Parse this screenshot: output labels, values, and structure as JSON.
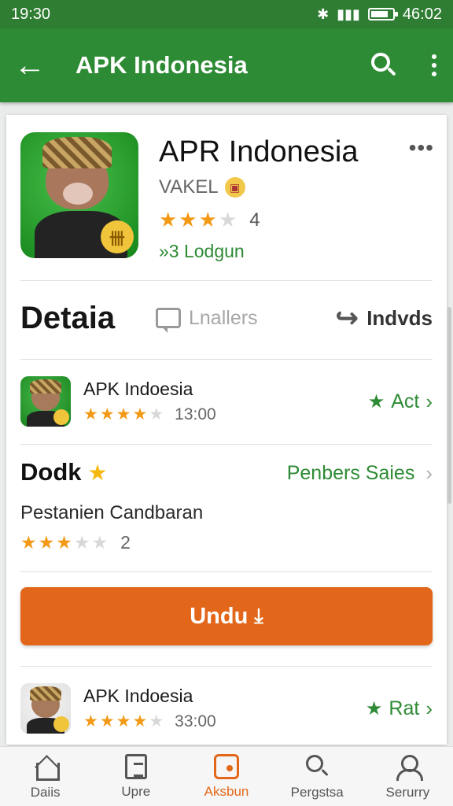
{
  "status_bar": {
    "time": "19:30",
    "right_text": "46:02",
    "icons": [
      "bluetooth-icon",
      "signal-icon",
      "battery-icon"
    ]
  },
  "app_bar": {
    "title": "APK Indonesia",
    "icons": [
      "back-arrow-icon",
      "search-icon",
      "more-vert-icon"
    ]
  },
  "app_header": {
    "name": "APR Indonesia",
    "developer": "VAKEL",
    "rating_stars": 3,
    "rating_value": "4",
    "downloads": "»3 Lodgun",
    "badge_glyph": "卌"
  },
  "tabs": {
    "details": "Detaia",
    "reviews": "Lnallers",
    "share": "Indvds"
  },
  "rows": [
    {
      "title": "APK Indoesia",
      "stars": 4,
      "time": "13:00",
      "action": "Act"
    },
    {
      "title": "APK Indoesia",
      "stars": 4,
      "time": "33:00",
      "action": "Rat"
    }
  ],
  "section2": {
    "title": "Dodk",
    "link": "Penbers Saies",
    "description": "Pestanien Candbaran",
    "rating_stars": 2.5,
    "rating_value": "2"
  },
  "download_button": {
    "label": "Undu"
  },
  "bottom_nav": [
    {
      "label": "Daiis",
      "icon": "home-icon",
      "active": false
    },
    {
      "label": "Upre",
      "icon": "document-icon",
      "active": false
    },
    {
      "label": "Aksbun",
      "icon": "app-icon",
      "active": true
    },
    {
      "label": "Pergstsa",
      "icon": "search-icon",
      "active": false
    },
    {
      "label": "Serurry",
      "icon": "user-icon",
      "active": false
    }
  ],
  "colors": {
    "primary_green": "#2e8b35",
    "status_green": "#2f7d32",
    "accent_orange": "#e2671a",
    "star_orange": "#f29a17"
  }
}
